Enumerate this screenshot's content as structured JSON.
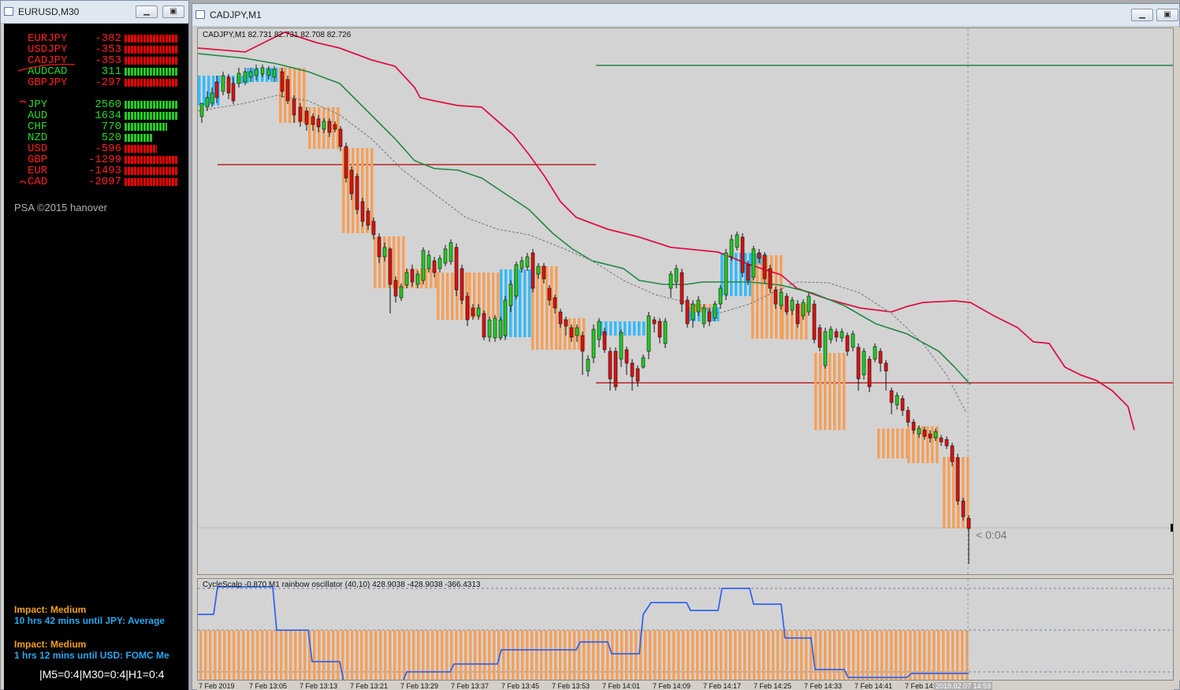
{
  "left_window": {
    "title": "EURUSD,M30",
    "min_icon": "minimize-icon",
    "max_icon": "restore-icon",
    "pairs": [
      {
        "name": "EURJPY",
        "value": "-382",
        "fill": 1.0,
        "color": "#ff1f1f",
        "bar_color": "#ff0000"
      },
      {
        "name": "USDJPY",
        "value": "-353",
        "fill": 1.0,
        "color": "#ff1f1f",
        "bar_color": "#ff0000"
      },
      {
        "name": "CADJPY",
        "value": "-353",
        "fill": 1.0,
        "color": "#ff1f1f",
        "bar_color": "#ff0000"
      },
      {
        "name": "AUDCAD",
        "value": "311",
        "fill": 1.0,
        "color": "#2ad42a",
        "bar_color": "#22cc22"
      },
      {
        "name": "GBPJPY",
        "value": "-297",
        "fill": 1.0,
        "color": "#ff1f1f",
        "bar_color": "#ff0000"
      }
    ],
    "currencies": [
      {
        "name": "JPY",
        "value": "2560",
        "fill": 1.0,
        "color": "#2ad42a",
        "bar_color": "#22cc22"
      },
      {
        "name": "AUD",
        "value": "1634",
        "fill": 1.0,
        "color": "#2ad42a",
        "bar_color": "#22cc22"
      },
      {
        "name": "CHF",
        "value": "770",
        "fill": 0.79,
        "color": "#2ad42a",
        "bar_color": "#22cc22"
      },
      {
        "name": "NZD",
        "value": "520",
        "fill": 0.53,
        "color": "#2ad42a",
        "bar_color": "#22cc22"
      },
      {
        "name": "USD",
        "value": "-596",
        "fill": 0.61,
        "color": "#ff1f1f",
        "bar_color": "#ff0000"
      },
      {
        "name": "GBP",
        "value": "-1299",
        "fill": 1.0,
        "color": "#ff1f1f",
        "bar_color": "#ff0000"
      },
      {
        "name": "EUR",
        "value": "-1493",
        "fill": 1.0,
        "color": "#ff1f1f",
        "bar_color": "#ff0000"
      },
      {
        "name": "CAD",
        "value": "-2097",
        "fill": 1.0,
        "color": "#ff1f1f",
        "bar_color": "#ff0000"
      }
    ],
    "copyright": "PSA ©2015 hanover",
    "news": [
      {
        "impact": "Impact: Medium",
        "text": "10 hrs 42 mins until JPY: Average"
      },
      {
        "impact": "Impact: Medium",
        "text": "1 hrs 12 mins until USD: FOMC Me"
      }
    ],
    "timeframes": "|M5=0:4|M30=0:4|H1=0:4"
  },
  "chart_window": {
    "title": "CADJPY,M1",
    "min_icon": "minimize-icon",
    "max_icon": "restore-icon",
    "close_icon": "close-icon",
    "header": "CADJPY,M1  82.731 82.731 82.708 82.726",
    "oscillator_header": "CycleScalp -0.870  M1 rainbow oscillator (40,10) 428.9038 -428.9038 -366.4313",
    "countdown": "< 0:04",
    "time_labels": [
      "7 Feb 2019",
      "7 Feb 13:05",
      "7 Feb 13:13",
      "7 Feb 13:21",
      "7 Feb 13:29",
      "7 Feb 13:37",
      "7 Feb 13:45",
      "7 Feb 13:53",
      "7 Feb 14:01",
      "7 Feb 14:09",
      "7 Feb 14:17",
      "7 Feb 14:25",
      "7 Feb 14:33",
      "7 Feb 14:41",
      "7 Feb 14:"
    ],
    "current_time_label": "2019.02.07 14:59",
    "colors": {
      "bull": "#22cc22",
      "bear": "#dd1111",
      "orange": "#f5a05a",
      "blue": "#33bbff",
      "red_line": "#dd1144",
      "green_line": "#228844",
      "hline": "#bb2222",
      "osc_line": "#3366ee"
    }
  }
}
